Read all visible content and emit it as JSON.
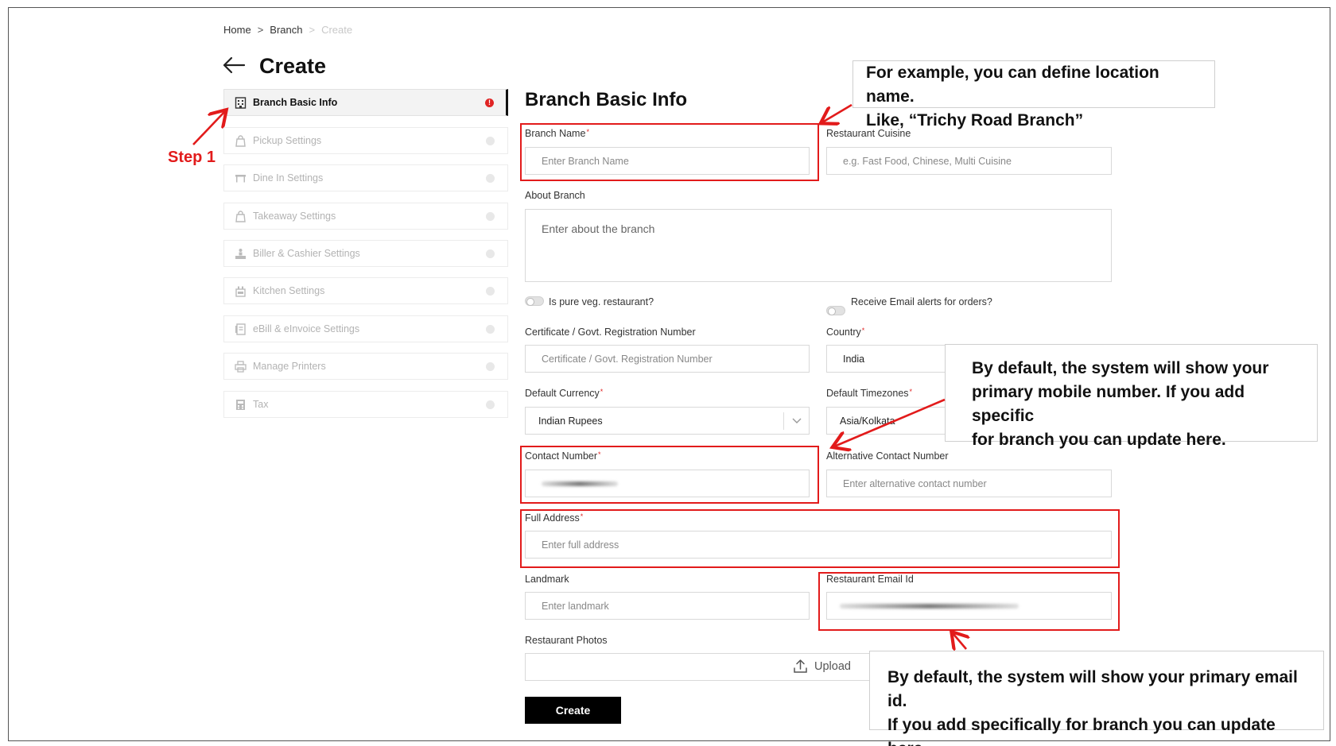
{
  "breadcrumb": {
    "home": "Home",
    "branch": "Branch",
    "current": "Create",
    "sep": ">"
  },
  "page": {
    "title": "Create"
  },
  "sidebar": {
    "items": [
      {
        "label": "Branch Basic Info",
        "icon": "building-icon",
        "alert": "!"
      },
      {
        "label": "Pickup Settings",
        "icon": "bag-icon"
      },
      {
        "label": "Dine In Settings",
        "icon": "table-icon"
      },
      {
        "label": "Takeaway Settings",
        "icon": "bag-icon"
      },
      {
        "label": "Biller & Cashier Settings",
        "icon": "cashier-icon"
      },
      {
        "label": "Kitchen Settings",
        "icon": "kitchen-icon"
      },
      {
        "label": "eBill & eInvoice Settings",
        "icon": "receipt-icon"
      },
      {
        "label": "Manage Printers",
        "icon": "printer-icon"
      },
      {
        "label": "Tax",
        "icon": "calculator-icon"
      }
    ]
  },
  "form": {
    "section_title": "Branch Basic Info",
    "branch_name": {
      "label": "Branch Name",
      "required": "*",
      "placeholder": "Enter Branch Name"
    },
    "cuisine": {
      "label": "Restaurant Cuisine",
      "placeholder": "e.g. Fast Food, Chinese, Multi Cuisine"
    },
    "about": {
      "label": "About Branch",
      "placeholder": "Enter about the branch"
    },
    "pure_veg": {
      "label": "Is pure veg. restaurant?"
    },
    "email_alerts": {
      "label": "Receive Email alerts for orders?"
    },
    "certificate": {
      "label": "Certificate / Govt. Registration Number",
      "placeholder": "Certificate / Govt. Registration Number"
    },
    "country": {
      "label": "Country",
      "required": "*",
      "value": "India"
    },
    "currency": {
      "label": "Default Currency",
      "required": "*",
      "value": "Indian Rupees"
    },
    "timezone": {
      "label": "Default Timezones",
      "required": "*",
      "value": "Asia/Kolkata"
    },
    "contact": {
      "label": "Contact Number",
      "required": "*"
    },
    "alt_contact": {
      "label": "Alternative Contact Number",
      "placeholder": "Enter alternative contact number"
    },
    "address": {
      "label": "Full Address",
      "required": "*",
      "placeholder": "Enter full address"
    },
    "landmark": {
      "label": "Landmark",
      "placeholder": "Enter landmark"
    },
    "email": {
      "label": "Restaurant Email Id"
    },
    "photos": {
      "label": "Restaurant Photos",
      "upload_label": "Upload"
    },
    "submit_label": "Create"
  },
  "annotations": {
    "step1": "Step 1",
    "callout_branch_line1": "For example, you can define location name.",
    "callout_branch_line2": "Like, “Trichy Road Branch”",
    "callout_mobile_line1": "By default, the system will show your",
    "callout_mobile_line2": "primary mobile number. If you add specific",
    "callout_mobile_line3": "for branch you can update here.",
    "callout_email_line1": "By default, the system will show your primary email id.",
    "callout_email_line2": "If you add specifically for branch you can update here.",
    "accent_color": "#e21b1b"
  }
}
